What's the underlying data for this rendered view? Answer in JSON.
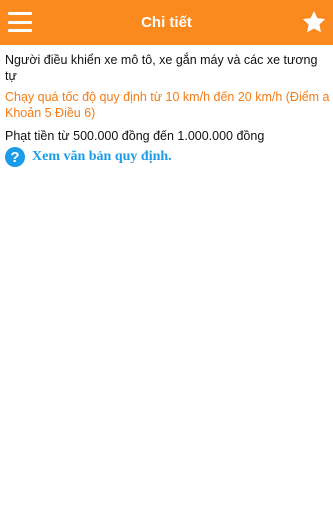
{
  "appbar": {
    "title": "Chi tiết",
    "menu_icon": "hamburger-menu-icon",
    "favorite_icon": "star-icon",
    "background_color": "#fb8a1e"
  },
  "detail": {
    "subject": "Người điều khiển xe mô tô, xe gắn máy và các xe tương tự",
    "violation": "Chạy quá tốc độ quy định từ 10 km/h đến 20 km/h (Điểm a Khoản 5 Điều 6)",
    "penalty": "Phạt tiền từ 500.000 đồng đến 1.000.000 đồng",
    "regulation_link": "Xem văn bản quy định.",
    "regulation_icon": "help-icon",
    "violation_color": "#f57c16",
    "link_color": "#1a9cea"
  }
}
